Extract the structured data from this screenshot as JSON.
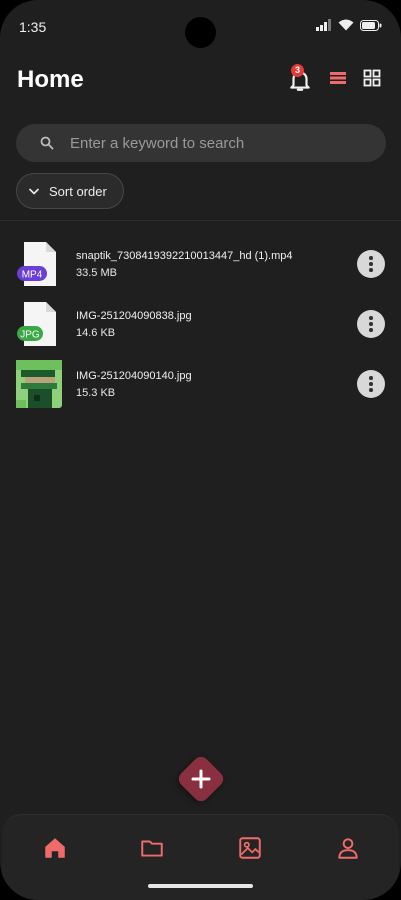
{
  "status_bar": {
    "time": "1:35"
  },
  "header": {
    "title": "Home",
    "notification_count": "3"
  },
  "search": {
    "placeholder": "Enter a keyword to search"
  },
  "sort": {
    "label": "Sort order"
  },
  "files": [
    {
      "name": "snaptik_7308419392210013447_hd (1).mp4",
      "size": "33.5 MB",
      "type_label": "MP4",
      "icon": "mp4-file-icon"
    },
    {
      "name": "IMG-251204090838.jpg",
      "size": "14.6 KB",
      "type_label": "JPG",
      "icon": "jpg-file-icon"
    },
    {
      "name": "IMG-251204090140.jpg",
      "size": "15.3 KB",
      "type_label": "",
      "icon": "image-thumbnail"
    }
  ],
  "nav": [
    "home-icon",
    "folder-icon",
    "image-icon",
    "profile-icon"
  ],
  "colors": {
    "accent": "#ef6b6b",
    "fab": "#8a2f40",
    "background": "#1f1f1f",
    "mp4": "#6a3fd6",
    "jpg": "#3aa845"
  }
}
